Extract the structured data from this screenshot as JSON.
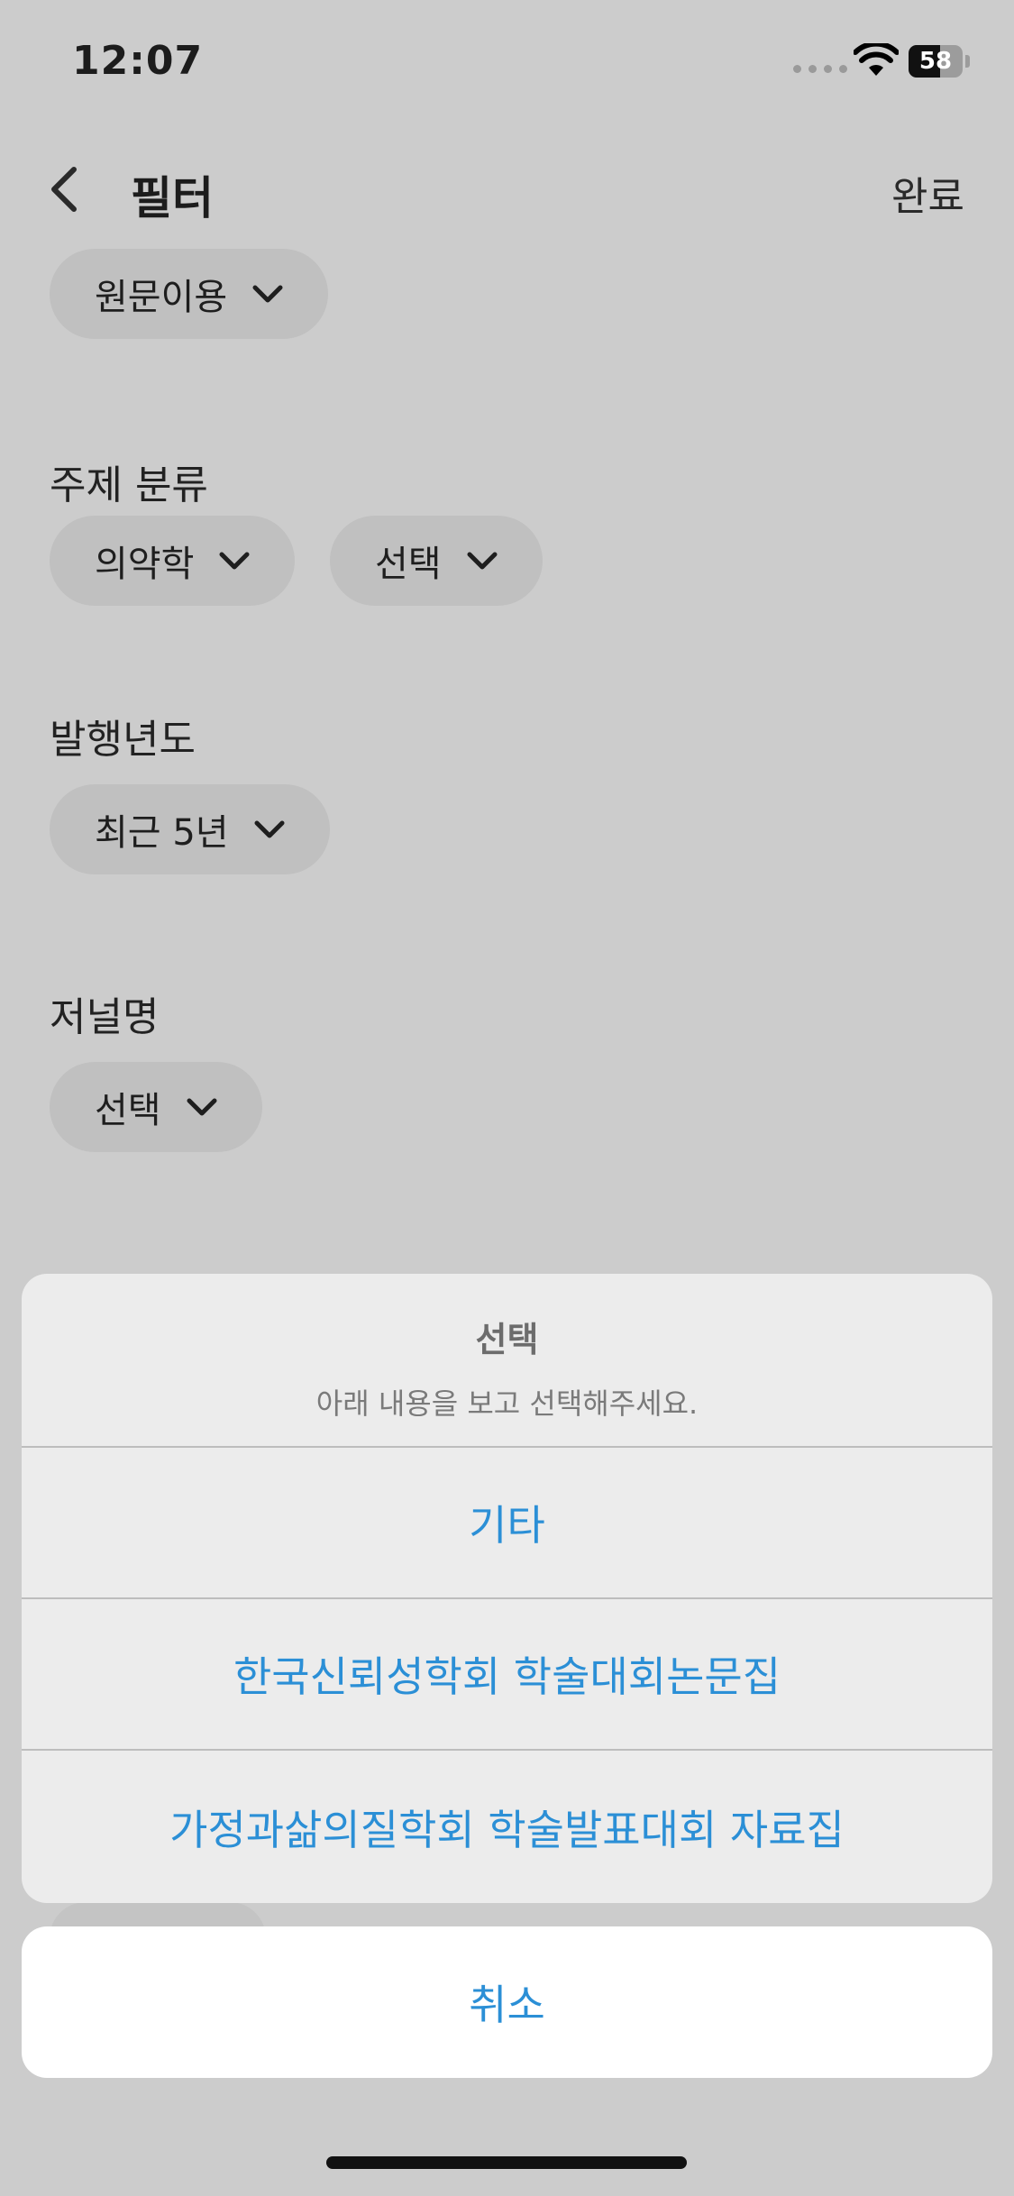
{
  "status_bar": {
    "time": "12:07",
    "battery": "58",
    "battery_level": 0.58
  },
  "nav": {
    "title": "필터",
    "done_label": "완료"
  },
  "filters": {
    "original_use": {
      "value": "원문이용"
    },
    "subject": {
      "title": "주제 분류",
      "primary": "의약학",
      "secondary": "선택"
    },
    "year": {
      "title": "발행년도",
      "value": "최근 5년"
    },
    "journal": {
      "title": "저널명",
      "value": "선택"
    }
  },
  "action_sheet": {
    "title": "선택",
    "subtitle": "아래 내용을 보고 선택해주세요.",
    "options": [
      {
        "label": "기타"
      },
      {
        "label": "한국신뢰성학회 학술대회논문집"
      },
      {
        "label": "가정과삶의질학회 학술발표대회 자료집"
      }
    ],
    "cancel_label": "취소"
  },
  "colors": {
    "backdrop": "#cccccc",
    "accent": "#2b8fd6",
    "sheet": "#ececec"
  },
  "icons": {
    "back": "chevron-left-icon",
    "dropdown": "chevron-down-icon",
    "wifi": "wifi-icon"
  }
}
